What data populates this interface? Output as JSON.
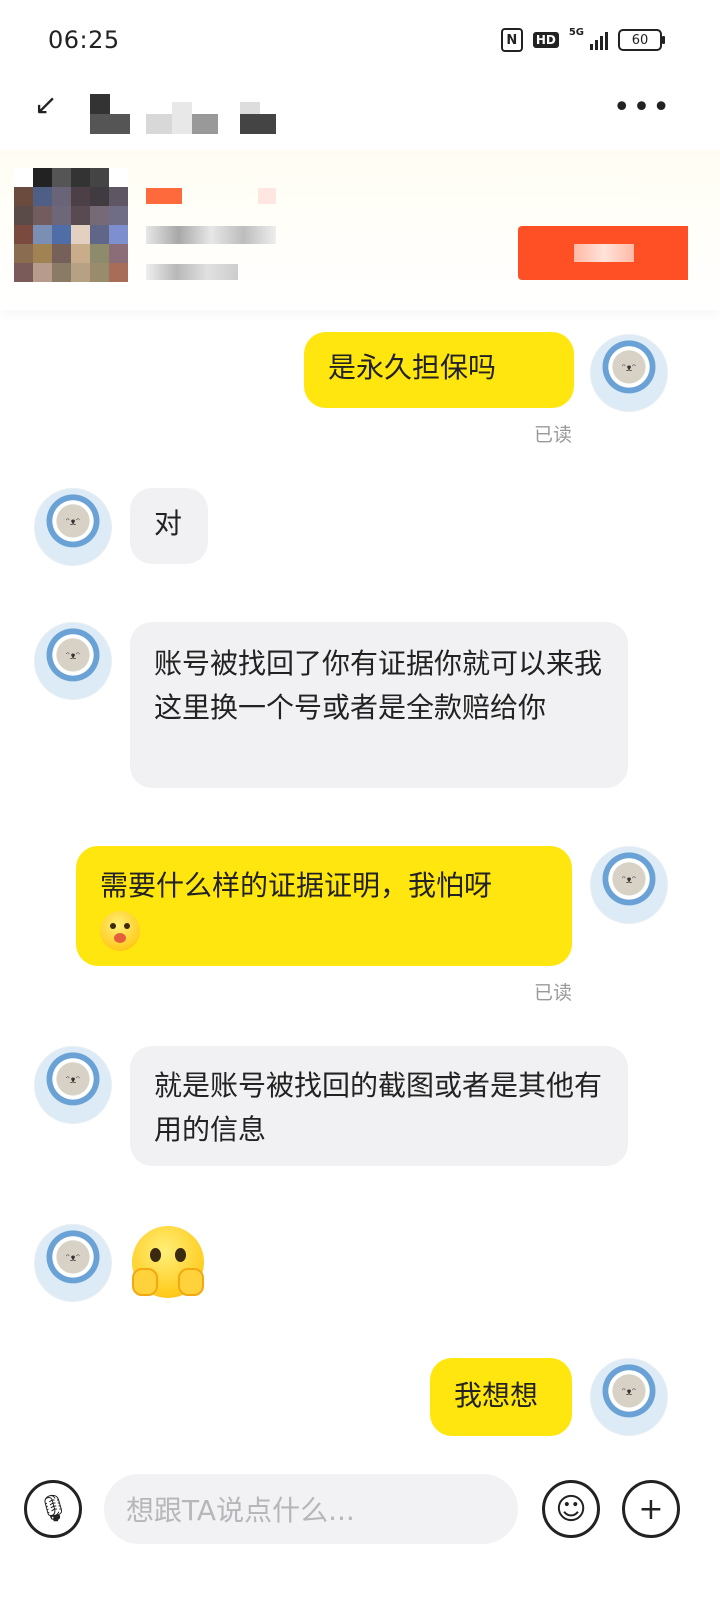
{
  "status_bar": {
    "time": "06:25",
    "network": "5G",
    "hd": "HD",
    "battery": "60"
  },
  "chat": {
    "messages": [
      {
        "side": "me",
        "text": "是永久担保吗",
        "status": "已读"
      },
      {
        "side": "them",
        "text": "对"
      },
      {
        "side": "them",
        "text": "账号被找回了你有证据你就可以来我这里换一个号或者是全款赔给你"
      },
      {
        "side": "me",
        "text": "需要什么样的证据证明，我怕呀",
        "status": "已读"
      },
      {
        "side": "them",
        "text": "就是账号被找回的截图或者是其他有用的信息"
      },
      {
        "side": "them",
        "type": "emoji"
      },
      {
        "side": "me",
        "text": "我想想"
      }
    ]
  },
  "input_bar": {
    "placeholder": "想跟TA说点什么..."
  }
}
